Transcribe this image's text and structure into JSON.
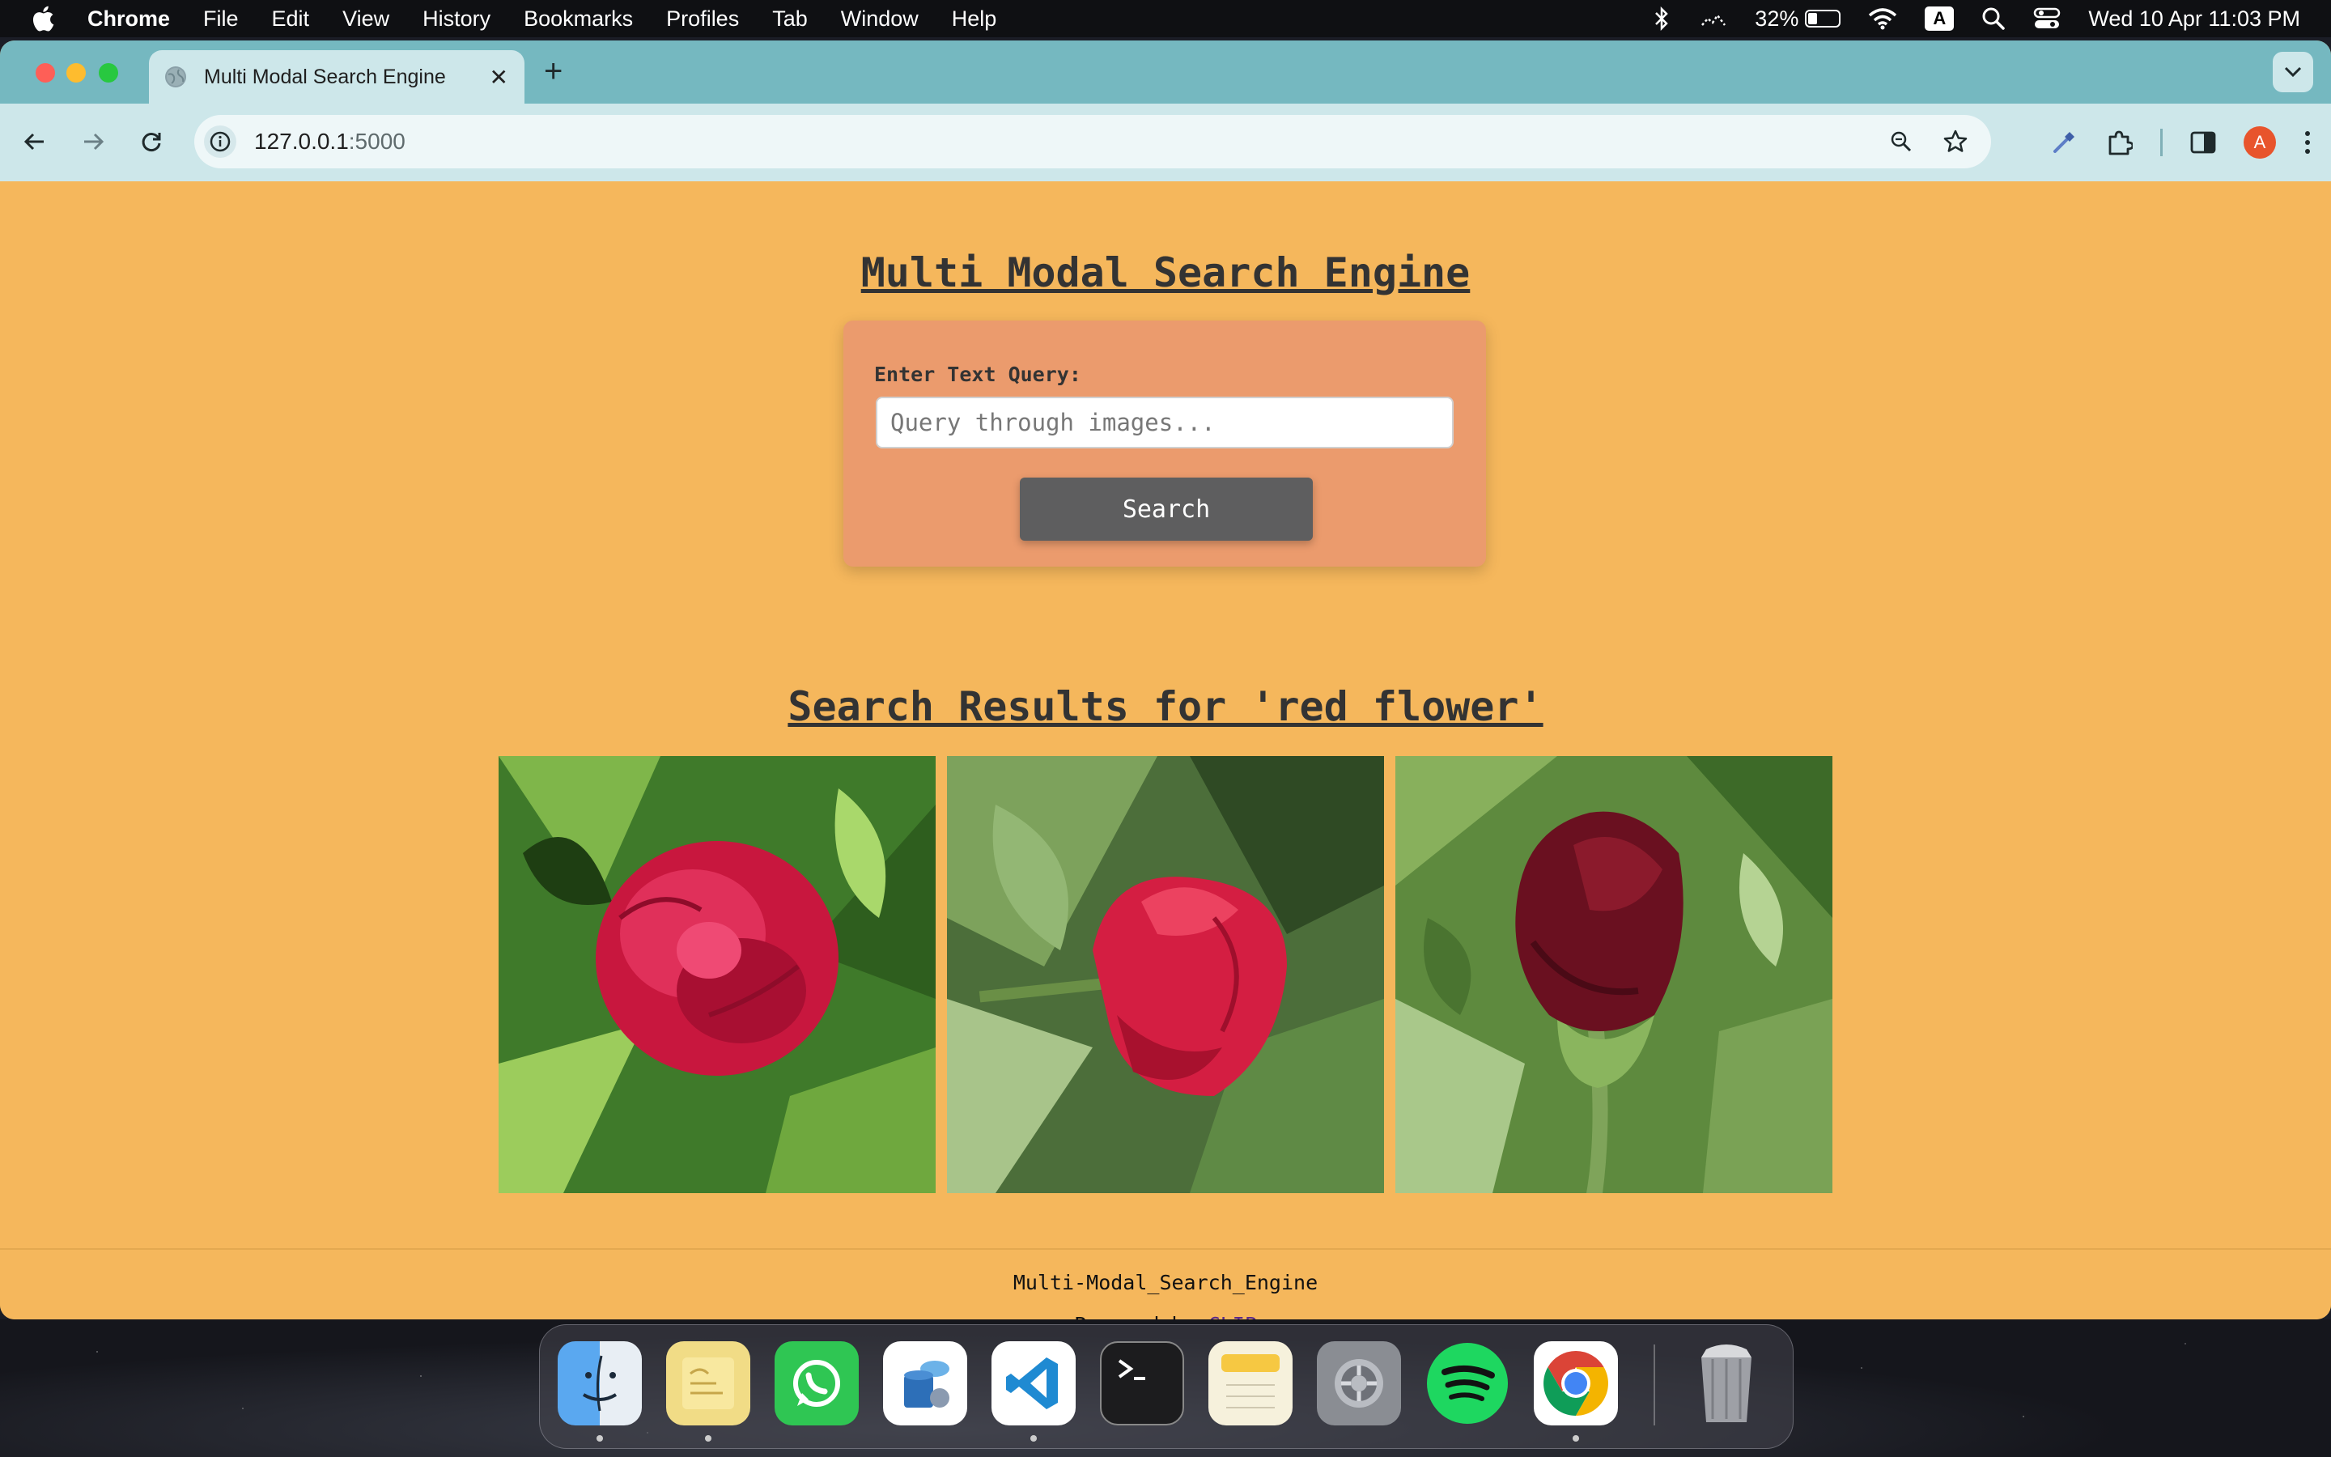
{
  "menubar": {
    "app_name": "Chrome",
    "menus": [
      "File",
      "Edit",
      "View",
      "History",
      "Bookmarks",
      "Profiles",
      "Tab",
      "Window",
      "Help"
    ],
    "battery_percent": "32%",
    "input_source": "A",
    "datetime": "Wed 10 Apr  11:03 PM"
  },
  "browser": {
    "tab_title": "Multi Modal Search Engine",
    "url_host": "127.0.0.1",
    "url_port": ":5000",
    "profile_initial": "A"
  },
  "page": {
    "title": "Multi Modal Search Engine",
    "query_label": "Enter Text Query:",
    "query_placeholder": "Query through images...",
    "search_button": "Search",
    "results_title": "Search Results for 'red flower'",
    "results": [
      {
        "icon": "red-peony-image"
      },
      {
        "icon": "red-rose-bud-image"
      },
      {
        "icon": "dark-red-rose-image"
      }
    ],
    "footer_name": "Multi-Modal_Search_Engine",
    "footer_powered_prefix": "Powered by",
    "footer_powered_link": "CLIP"
  },
  "dock": {
    "apps": [
      "Finder",
      "Stickies",
      "WhatsApp",
      "Data App",
      "Visual Studio Code",
      "Terminal",
      "Notes",
      "System Settings",
      "Spotify",
      "Google Chrome",
      "Trash"
    ]
  },
  "colors": {
    "page_background": "#f5b75c",
    "card_background": "#eb9b6d",
    "button_background": "#5e5e5f",
    "tabstrip": "#75b8c0",
    "toolbar": "#cde7ea"
  }
}
